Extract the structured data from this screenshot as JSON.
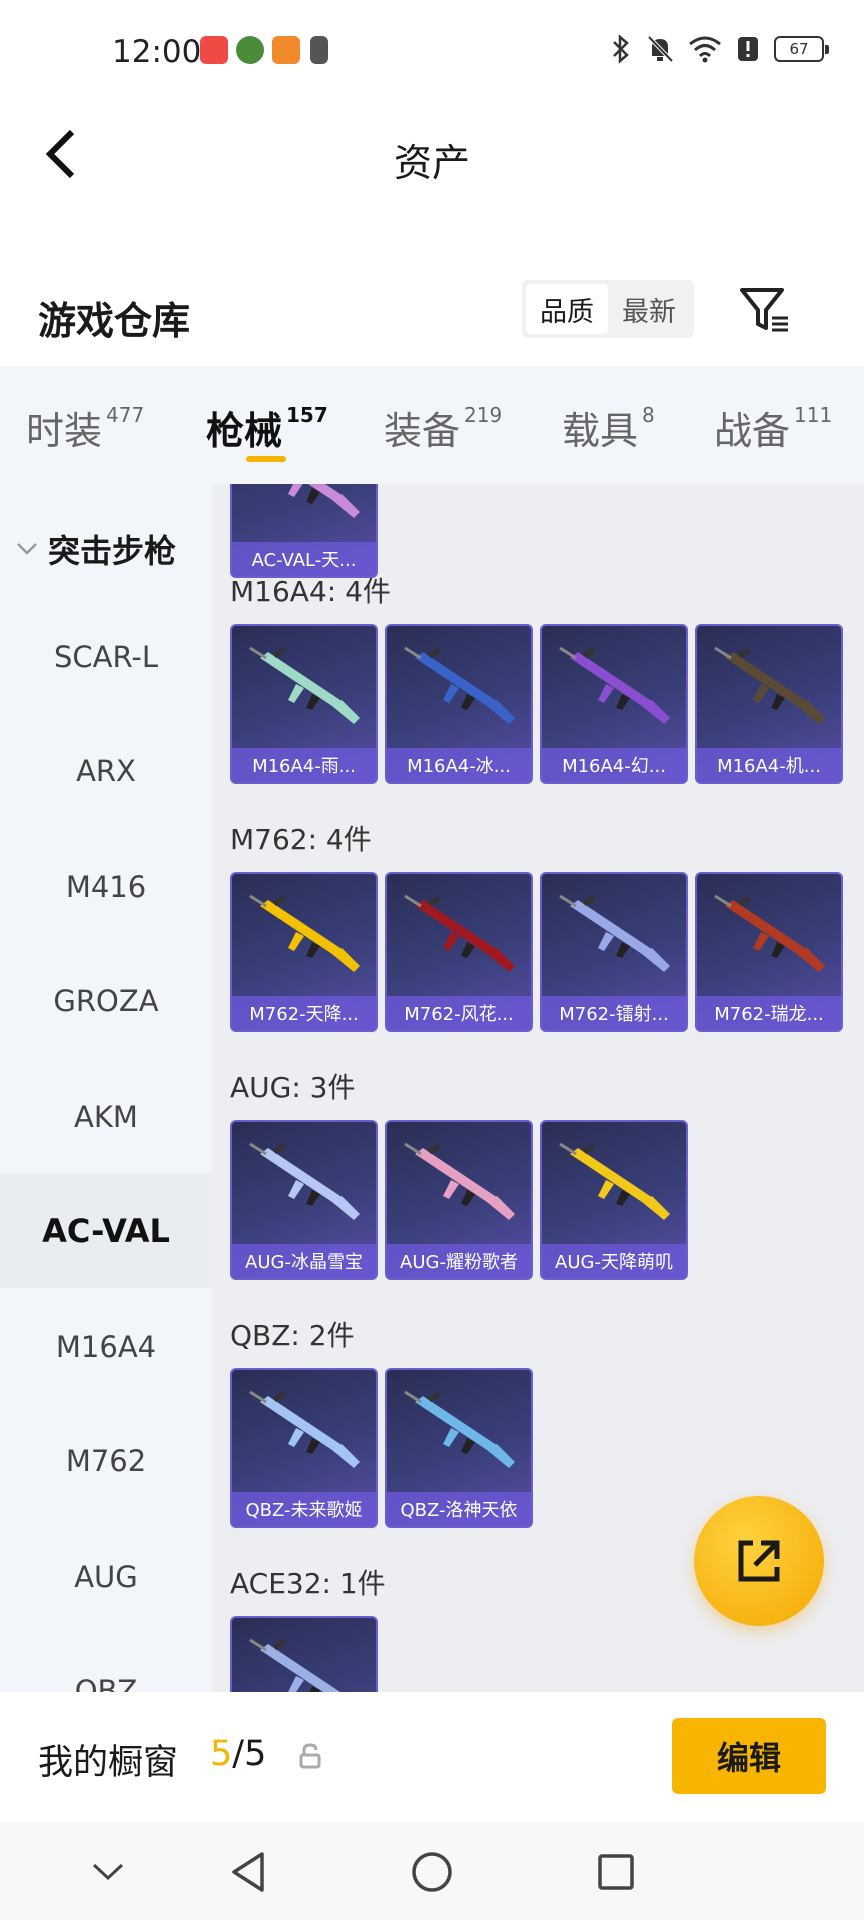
{
  "status_bar": {
    "time": "12:00",
    "battery": "67",
    "icons": [
      "bluetooth-icon",
      "mute-icon",
      "wifi-icon",
      "alert-icon"
    ]
  },
  "header": {
    "title": "资产",
    "back_icon": "chevron-left-icon"
  },
  "section": {
    "title": "游戏仓库",
    "sort_options": [
      "品质",
      "最新"
    ],
    "sort_active": "品质",
    "filter_icon": "filter-icon"
  },
  "tabs": [
    {
      "label": "时装",
      "count": "477",
      "active": false
    },
    {
      "label": "枪械",
      "count": "157",
      "active": true
    },
    {
      "label": "装备",
      "count": "219",
      "active": false
    },
    {
      "label": "载具",
      "count": "8",
      "active": false
    },
    {
      "label": "战备",
      "count": "111",
      "active": false
    }
  ],
  "sidebar": {
    "category": "突击步枪",
    "items": [
      {
        "label": "SCAR-L",
        "active": false
      },
      {
        "label": "ARX",
        "active": false
      },
      {
        "label": "M416",
        "active": false
      },
      {
        "label": "GROZA",
        "active": false
      },
      {
        "label": "AKM",
        "active": false
      },
      {
        "label": "AC-VAL",
        "active": true
      },
      {
        "label": "M16A4",
        "active": false
      },
      {
        "label": "M762",
        "active": false
      },
      {
        "label": "AUG",
        "active": false
      },
      {
        "label": "QBZ",
        "active": false
      }
    ]
  },
  "groups": [
    {
      "title": "",
      "items": [
        "AC-VAL-天..."
      ],
      "colors": [
        "#c98bd8"
      ]
    },
    {
      "title": "M16A4: 4件",
      "items": [
        "M16A4-雨...",
        "M16A4-冰...",
        "M16A4-幻...",
        "M16A4-机..."
      ],
      "colors": [
        "#9fd9c7",
        "#3a63c9",
        "#8a4fd0",
        "#5a4a36"
      ]
    },
    {
      "title": "M762: 4件",
      "items": [
        "M762-天降...",
        "M762-风花...",
        "M762-镭射...",
        "M762-瑞龙..."
      ],
      "colors": [
        "#f2c200",
        "#a01822",
        "#9aa8e8",
        "#b33a22"
      ]
    },
    {
      "title": "AUG: 3件",
      "items": [
        "AUG-冰晶雪宝",
        "AUG-耀粉歌者",
        "AUG-天降萌叽"
      ],
      "colors": [
        "#b7c6f2",
        "#e6a0c4",
        "#f2c81a"
      ]
    },
    {
      "title": "QBZ: 2件",
      "items": [
        "QBZ-未来歌姬",
        "QBZ-洛神天依"
      ],
      "colors": [
        "#a4c4f4",
        "#6fb7e8"
      ]
    },
    {
      "title": "ACE32: 1件",
      "items": [
        ""
      ],
      "colors": [
        "#9ab0e6"
      ]
    }
  ],
  "fab_icon": "share-icon",
  "bottom_bar": {
    "label": "我的橱窗",
    "current": "5",
    "total": "/5",
    "lock_icon": "lock-icon",
    "edit_label": "编辑"
  },
  "nav": [
    "chevron-down-icon",
    "back-triangle-icon",
    "home-circle-icon",
    "recents-square-icon"
  ],
  "colors": {
    "accent": "#f4b400",
    "card_border": "#6b5fd0"
  }
}
